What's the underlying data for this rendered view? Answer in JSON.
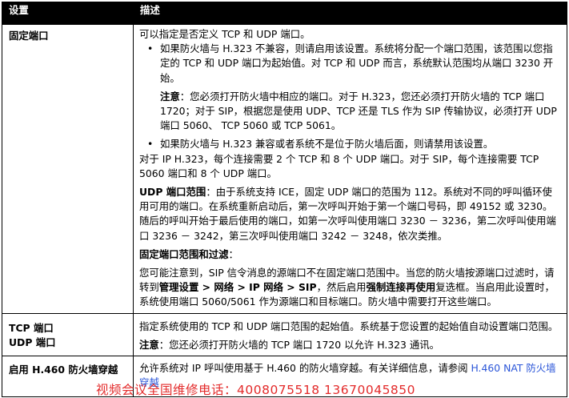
{
  "header": {
    "col_setting": "设置",
    "col_desc": "描述"
  },
  "rows": {
    "fixed_ports": {
      "name": "固定端口",
      "p1": "可以指定是否定义 TCP 和 UDP 端口。",
      "bullet_glyph": "•",
      "bullet1": "如果防火墙与 H.323 不兼容，则请启用该设置。系统将分配一个端口范围，该范围以您指定的 TCP 和 UDP 端口为起始值。对 TCP 和 UDP 而言，系统默认范围均从端口 3230 开始。",
      "note_label": "注意",
      "note_text": "：您必须打开防火墙中相应的端口。对于 H.323，您还必须打开防火墙的 TCP 端口 1720；对于 SIP，根据您是使用 UDP、TCP 还是 TLS 作为 SIP 传输协议，必须打开 UDP 端口 5060、 TCP 5060 或 TCP 5061。",
      "bullet2": "如果防火墙与 H.323 兼容或者系统不是位于防火墙后面，则请禁用该设置。",
      "p2": "对于 IP H.323，每个连接需要 2 个 TCP 和 8 个 UDP 端口。对于 SIP，每个连接需要 TCP 5060 端口和 8 个 UDP 端口。",
      "udp_label": "UDP 端口范围",
      "udp_text": "：由于系统支持 ICE，固定 UDP 端口的范围为 112。系统对不同的呼叫循环使用可用的端口。在系统重新启动后，第一次呼叫开始于第一个端口号码，即 49152 或 3230。随后的呼叫开始于最后使用的端口，如第一次呼叫使用端口 3230 － 3236，第二次呼叫使用端口 3236 － 3242，第三次呼叫使用端口 3242 － 3248，依次类推。",
      "range_label": "固定端口范围和过滤",
      "range_colon": "：",
      "p_final_1": "您可能注意到，SIP 信令消息的源端口不在固定端口范围中。当您的防火墙按源端口过滤时，请转到",
      "p_final_path": "管理设置 > 网络 > IP 网络 > SIP",
      "p_final_2": "，然后启用",
      "p_final_opt": "强制连接再使用",
      "p_final_3": "复选框。当启用此设置时，系统使用端口 5060/5061 作为源端口和目标端口。防火墙中需要打开这些端口。"
    },
    "tcp_udp": {
      "name_line1": "TCP 端口",
      "name_line2": "UDP 端口",
      "p1": "指定系统使用的 TCP 和 UDP 端口范围的起始值。系统基于您设置的起始值自动设置端口范围。",
      "note_label": "注意",
      "note_text": "：您还必须打开防火墙的 TCP 端口 1720 以允许 H.323 通讯。"
    },
    "h460": {
      "name": "启用 H.460 防火墙穿越",
      "p1": "允许系统对 IP 呼叫使用基于 H.460 的防火墙穿越。有关详细信息，请参阅 ",
      "link": "H.460 NAT 防火墙穿越"
    }
  },
  "footer_text": "视频会议全国维修电话：4008075518  13670045850",
  "colors": {
    "header_bg": "#000000",
    "link": "#2a55d8",
    "footer": "#e32b2b"
  }
}
